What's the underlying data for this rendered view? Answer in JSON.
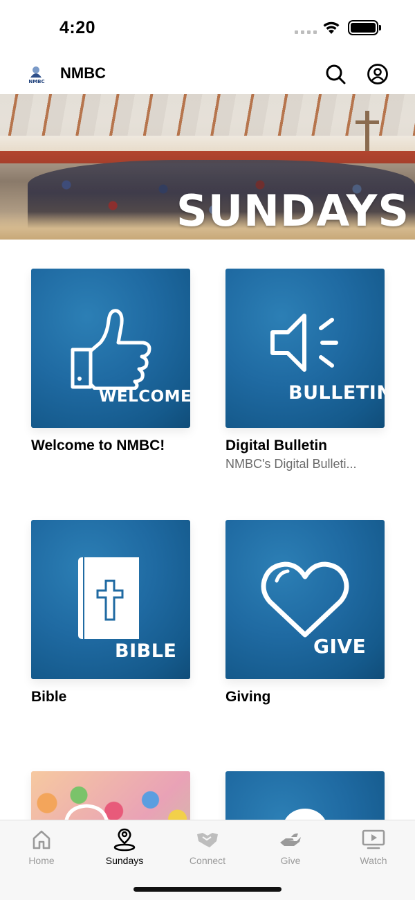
{
  "status_bar": {
    "time": "4:20"
  },
  "header": {
    "title": "NMBC",
    "logo_text": "NMBC"
  },
  "hero": {
    "title": "SUNDAYS"
  },
  "cards": [
    {
      "label": "WELCOME",
      "title": "Welcome to NMBC!",
      "subtitle": ""
    },
    {
      "label": "BULLETIN",
      "title": "Digital Bulletin",
      "subtitle": "NMBC's Digital Bulleti..."
    },
    {
      "label": "BIBLE",
      "title": "Bible",
      "subtitle": ""
    },
    {
      "label": "GIVE",
      "title": "Giving",
      "subtitle": ""
    }
  ],
  "tabs": [
    {
      "label": "Home",
      "icon": "home-icon"
    },
    {
      "label": "Sundays",
      "icon": "location-pin-icon",
      "active": true
    },
    {
      "label": "Connect",
      "icon": "handshake-icon"
    },
    {
      "label": "Give",
      "icon": "giving-hand-icon"
    },
    {
      "label": "Watch",
      "icon": "play-screen-icon"
    }
  ],
  "colors": {
    "card_blue": "#1f6aa2",
    "active_tab": "#000000",
    "inactive_tab": "#9a9a9a"
  }
}
